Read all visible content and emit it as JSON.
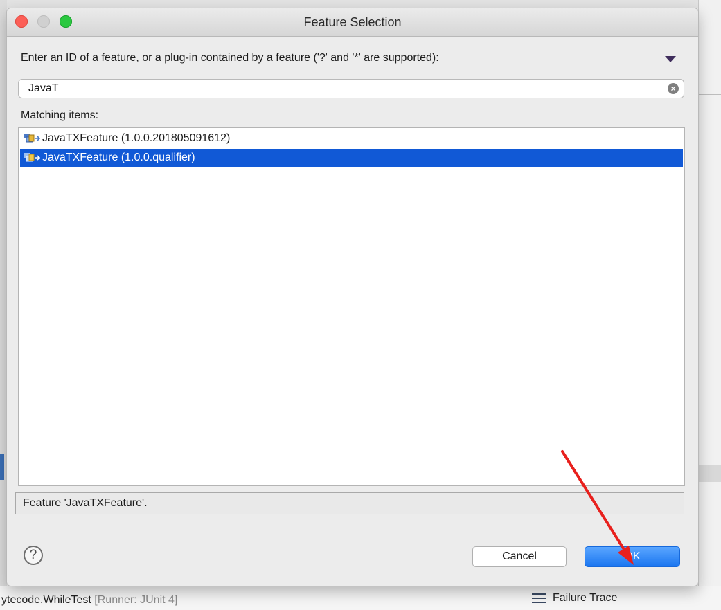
{
  "dialog": {
    "title": "Feature Selection",
    "prompt": "Enter an ID of a feature, or a plug-in contained by a feature ('?' and '*' are supported):",
    "search": {
      "value": "JavaT"
    },
    "matching_label": "Matching items:",
    "items": [
      {
        "label": "JavaTXFeature (1.0.0.201805091612)",
        "selected": false,
        "icon": "feature-icon"
      },
      {
        "label": "JavaTXFeature (1.0.0.qualifier)",
        "selected": true,
        "icon": "feature-icon"
      }
    ],
    "status": "Feature 'JavaTXFeature'.",
    "buttons": {
      "cancel": "Cancel",
      "ok": "OK"
    }
  },
  "background": {
    "bottom_left_main": "ytecode.WhileTest",
    "bottom_left_suffix": "[Runner: JUnit 4]",
    "bottom_right": "Failure Trace"
  },
  "colors": {
    "selection": "#1159d6",
    "ok_button": "#1b76f0",
    "annotation_arrow": "#e8201d"
  }
}
